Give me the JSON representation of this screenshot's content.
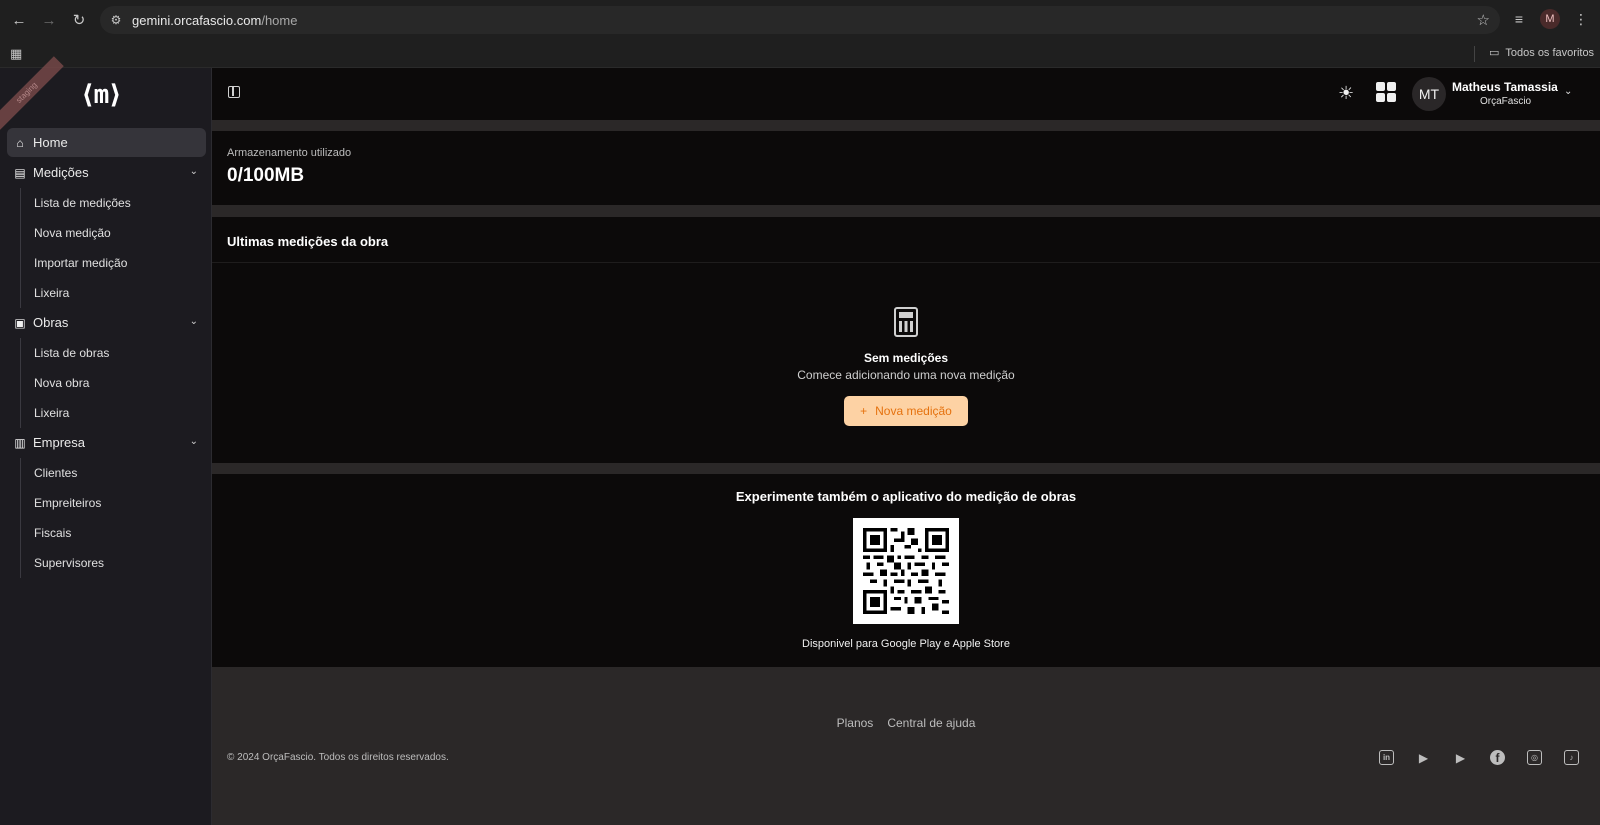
{
  "browser": {
    "url_host": "gemini.orcafascio.com",
    "url_path": "/home",
    "profile_initial": "M",
    "bookmarks_folder": "Todos os favoritos"
  },
  "sidebar": {
    "logo": "⟨m⟩",
    "badge": "staging",
    "items": [
      {
        "label": "Home",
        "icon": "home-icon",
        "active": true
      },
      {
        "label": "Medições",
        "icon": "calculator-icon",
        "children": [
          "Lista de medições",
          "Nova medição",
          "Importar medição",
          "Lixeira"
        ]
      },
      {
        "label": "Obras",
        "icon": "briefcase-icon",
        "children": [
          "Lista de obras",
          "Nova obra",
          "Lixeira"
        ]
      },
      {
        "label": "Empresa",
        "icon": "building-icon",
        "children": [
          "Clientes",
          "Empreiteiros",
          "Fiscais",
          "Supervisores"
        ]
      }
    ]
  },
  "header": {
    "avatar_initials": "MT",
    "user_name": "Matheus Tamassia",
    "company": "OrçaFascio"
  },
  "storage": {
    "label": "Armazenamento utilizado",
    "value": "0/100MB"
  },
  "latest": {
    "title": "Ultimas medições da obra",
    "empty_title": "Sem medições",
    "empty_subtitle": "Comece adicionando uma nova medição",
    "add_button": "Nova medição"
  },
  "app_promo": {
    "title": "Experimente também o aplicativo do medição de obras",
    "availability": "Disponivel para Google Play e Apple Store"
  },
  "footer": {
    "links": [
      "Planos",
      "Central de ajuda"
    ],
    "copyright": "© 2024 OrçaFascio. Todos os direitos reservados."
  }
}
